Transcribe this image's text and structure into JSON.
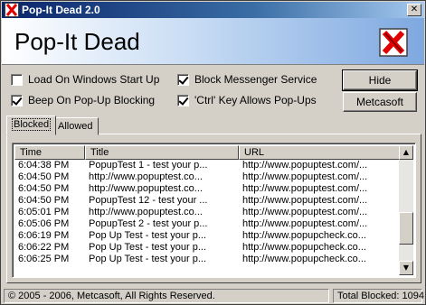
{
  "window": {
    "title": "Pop-It Dead 2.0",
    "close_glyph": "✕",
    "app_icon": "red-x-icon"
  },
  "banner": {
    "title": "Pop-It Dead",
    "logo_icon": "red-x-logo-icon"
  },
  "options": {
    "load_on_startup": {
      "label": "Load On Windows Start Up",
      "checked": false
    },
    "block_messenger": {
      "label": "Block Messenger Service",
      "checked": true
    },
    "beep_on_block": {
      "label": "Beep On Pop-Up Blocking",
      "checked": true
    },
    "ctrl_allows": {
      "label": "'Ctrl' Key Allows Pop-Ups",
      "checked": true
    }
  },
  "buttons": {
    "hide": "Hide",
    "metcasoft": "Metcasoft"
  },
  "tabs": [
    {
      "label": "Blocked",
      "active": true
    },
    {
      "label": "Allowed",
      "active": false
    }
  ],
  "table": {
    "columns": [
      "Time",
      "Title",
      "URL"
    ],
    "rows": [
      {
        "time": "6:04:38 PM",
        "title": "PopupTest 1 - test your p...",
        "url": "http://www.popuptest.com/..."
      },
      {
        "time": "6:04:50 PM",
        "title": "http://www.popuptest.co...",
        "url": "http://www.popuptest.com/..."
      },
      {
        "time": "6:04:50 PM",
        "title": "http://www.popuptest.co...",
        "url": "http://www.popuptest.com/..."
      },
      {
        "time": "6:04:50 PM",
        "title": "PopupTest 12 - test your ...",
        "url": "http://www.popuptest.com/..."
      },
      {
        "time": "6:05:01 PM",
        "title": "http://www.popuptest.co...",
        "url": "http://www.popuptest.com/..."
      },
      {
        "time": "6:05:06 PM",
        "title": "PopupTest 2 - test your p...",
        "url": "http://www.popuptest.com/..."
      },
      {
        "time": "6:06:19 PM",
        "title": "Pop Up Test - test your p...",
        "url": "http://www.popupcheck.co..."
      },
      {
        "time": "6:06:22 PM",
        "title": "Pop Up Test - test your p...",
        "url": "http://www.popupcheck.co..."
      },
      {
        "time": "6:06:25 PM",
        "title": "Pop Up Test - test your p...",
        "url": "http://www.popupcheck.co..."
      }
    ]
  },
  "scrollbar": {
    "up_glyph": "▲",
    "down_glyph": "▼"
  },
  "status": {
    "copyright": "© 2005 - 2006, Metcasoft, All Rights Reserved.",
    "total": "Total Blocked: 1094"
  },
  "colors": {
    "title_gradient_start": "#0a246a",
    "title_gradient_end": "#a6caf0",
    "logo_red": "#e00000"
  }
}
